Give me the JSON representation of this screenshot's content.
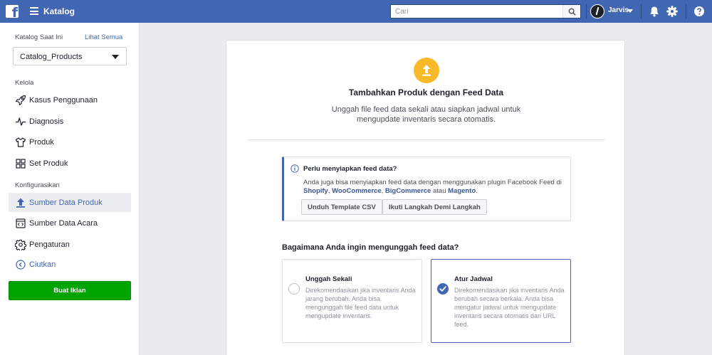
{
  "topbar": {
    "app_title": "Katalog",
    "search_placeholder": "Cari",
    "user_name": "Jarvis"
  },
  "sidebar": {
    "current_catalog_label": "Katalog Saat Ini",
    "see_all_link": "Lihat Semua",
    "selected_catalog": "Catalog_Products",
    "manage_section": "Kelola",
    "manage_items": [
      {
        "label": "Kasus Penggunaan",
        "icon": "rocket-icon"
      },
      {
        "label": "Diagnosis",
        "icon": "pulse-icon"
      },
      {
        "label": "Produk",
        "icon": "shirt-icon"
      },
      {
        "label": "Set Produk",
        "icon": "grid-icon"
      }
    ],
    "config_section": "Konfigurasikan",
    "config_items": [
      {
        "label": "Sumber Data Produk",
        "icon": "upload-icon",
        "active": true
      },
      {
        "label": "Sumber Data Acara",
        "icon": "code-file-icon"
      },
      {
        "label": "Pengaturan",
        "icon": "gear-icon"
      }
    ],
    "collapse_label": "Ciutkan",
    "create_ad_label": "Buat Iklan"
  },
  "main": {
    "title": "Tambahkan Produk dengan Feed Data",
    "description": "Unggah file feed data sekali atau siapkan jadwal untuk mengupdate inventaris secara otomatis.",
    "info": {
      "title": "Perlu menyiapkan feed data?",
      "text_prefix": "Anda juga bisa menyiapkan feed data dengan menggunakan plugin Facebook Feed di ",
      "platforms": [
        "Shopify",
        "WooCommerce",
        "BigCommerce",
        "Magento"
      ],
      "sep_comma": ", ",
      "sep_or": " atau ",
      "text_suffix": ".",
      "button_download": "Unduh Template CSV",
      "button_steps": "Ikuti Langkah Demi Langkah"
    },
    "question": "Bagaimana Anda ingin mengunggah feed data?",
    "options": [
      {
        "title": "Unggah Sekali",
        "description": "Direkomendasikan jika inventaris Anda jarang berubah. Anda bisa mengunggah file feed data untuk mengupdate inventaris.",
        "selected": false
      },
      {
        "title": "Atur Jadwal",
        "description": "Direkomendasikan jika inventaris Anda berubah secara berkala. Anda bisa mengatur jadwal untuk mengupdate inventaris secara otomatis dari URL feed.",
        "selected": true
      }
    ]
  },
  "colors": {
    "brand_blue": "#4267b2",
    "create_green": "#00a400",
    "upload_yellow": "#f7b928"
  }
}
